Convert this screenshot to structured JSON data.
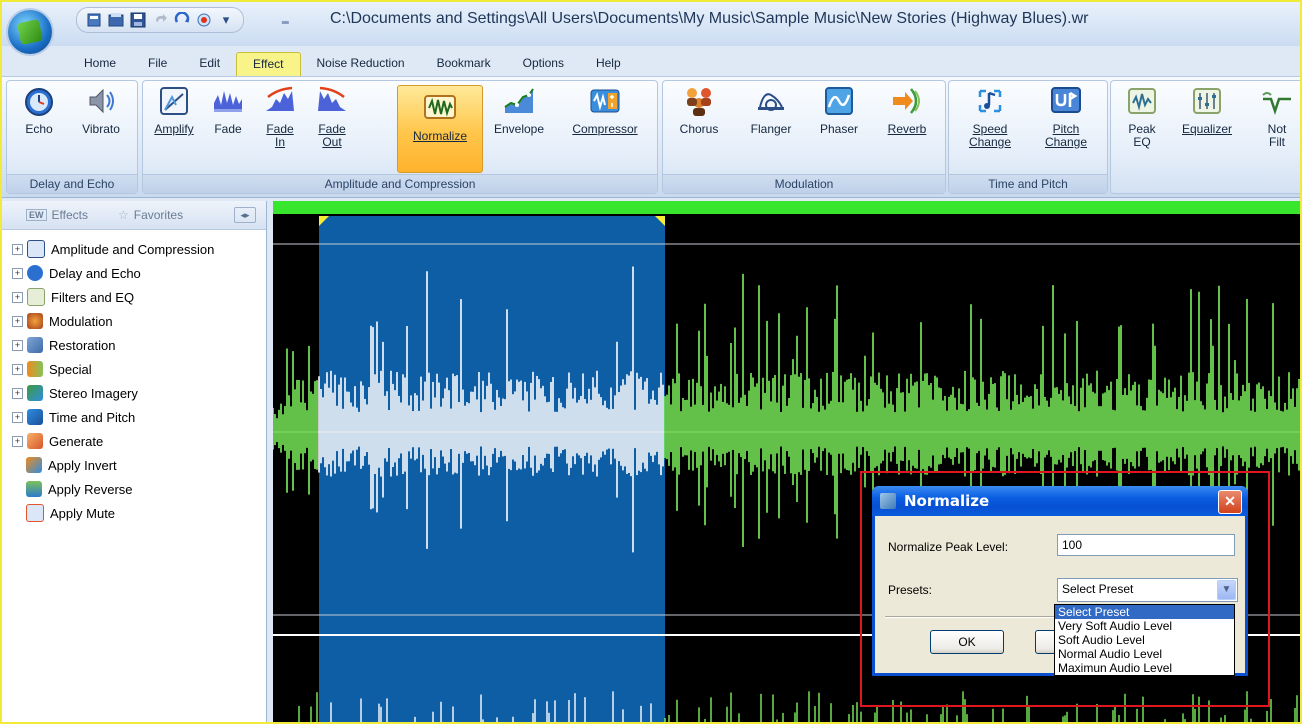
{
  "window": {
    "title": "C:\\Documents and Settings\\All Users\\Documents\\My Music\\Sample Music\\New Stories (Highway Blues).wr"
  },
  "qat": {
    "icons": [
      "new-file-icon",
      "open-file-icon",
      "save-icon",
      "undo-icon",
      "redo-icon",
      "record-icon"
    ],
    "more": "▾ ‗"
  },
  "menu": {
    "tabs": [
      "Home",
      "File",
      "Edit",
      "Effect",
      "Noise Reduction",
      "Bookmark",
      "Options",
      "Help"
    ],
    "active": "Effect"
  },
  "ribbon": {
    "groups": [
      {
        "label": "Delay and Echo",
        "buttons": [
          "Echo",
          "Vibrato"
        ]
      },
      {
        "label": "Amplitude and Compression",
        "buttons": [
          "Amplify",
          "Fade",
          "Fade\nIn",
          "Fade\nOut",
          "Normalize",
          "Envelope",
          "Compressor"
        ]
      },
      {
        "label": "Modulation",
        "buttons": [
          "Chorus",
          "Flanger",
          "Phaser",
          "Reverb"
        ]
      },
      {
        "label": "Time and Pitch",
        "buttons": [
          "Speed\nChange",
          "Pitch\nChange"
        ]
      },
      {
        "label": "",
        "buttons": [
          "Peak\nEQ",
          "Equalizer",
          "Not\nFilt"
        ]
      }
    ],
    "active_button": "Normalize"
  },
  "side": {
    "tab_effects": "Effects",
    "tab_favorites": "Favorites",
    "arrows": "◂▸",
    "tree": [
      {
        "label": "Amplitude and Compression",
        "expandable": true
      },
      {
        "label": "Delay and Echo",
        "expandable": true
      },
      {
        "label": "Filters and EQ",
        "expandable": true
      },
      {
        "label": "Modulation",
        "expandable": true
      },
      {
        "label": "Restoration",
        "expandable": true
      },
      {
        "label": "Special",
        "expandable": true
      },
      {
        "label": "Stereo Imagery",
        "expandable": true
      },
      {
        "label": "Time and Pitch",
        "expandable": true
      },
      {
        "label": "Generate",
        "expandable": true
      },
      {
        "label": "Apply Invert",
        "expandable": false
      },
      {
        "label": "Apply Reverse",
        "expandable": false
      },
      {
        "label": "Apply Mute",
        "expandable": false
      }
    ]
  },
  "colors": {
    "wave": "#7cf05a",
    "selection": "#0e5ea6",
    "selected_wave": "#ffffff",
    "highlight_box": "#e0161c"
  },
  "dialog": {
    "title": "Normalize",
    "close": "✕",
    "peak_label": "Normalize Peak Level:",
    "peak_value": "100",
    "presets_label": "Presets:",
    "preset_selected": "Select Preset",
    "ok": "OK",
    "cancel": "",
    "preset_options": [
      "Select Preset",
      "Very Soft Audio Level",
      "Soft Audio Level",
      "Normal Audio Level",
      "Maximun Audio Level"
    ]
  }
}
